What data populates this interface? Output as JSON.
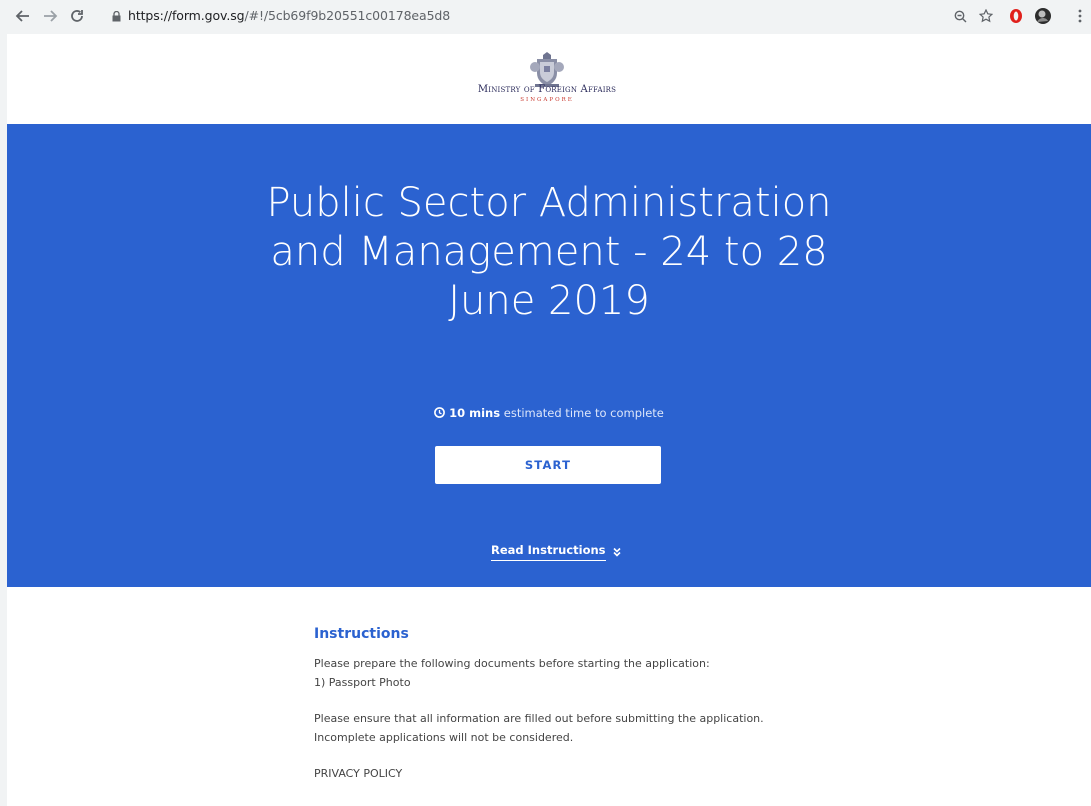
{
  "browser": {
    "url_host": "https://form.gov.sg",
    "url_path": "/#!/5cb69f9b20551c00178ea5d8",
    "icons": [
      "back-arrow-icon",
      "forward-arrow-icon",
      "reload-icon",
      "lock-icon",
      "zoom-icon",
      "star-icon",
      "opera-icon",
      "profile-icon",
      "menu-dots-icon"
    ]
  },
  "header": {
    "ministry_line": "Ministry of Foreign Affairs",
    "ministry_small": "SINGAPORE"
  },
  "hero": {
    "title": "Public Sector Administration and Management - 24 to 28 June 2019",
    "eta_value": "10 mins",
    "eta_text": "estimated time to complete",
    "start_label": "START",
    "read_instructions_label": "Read Instructions",
    "bg_color": "#2b62d0"
  },
  "instructions": {
    "title": "Instructions",
    "line1": "Please prepare the following documents before starting the application:",
    "line2": "1) Passport Photo",
    "line3": "Please ensure that all information are filled out before submitting the application.",
    "line4": "Incomplete applications will not be considered.",
    "line5": "PRIVACY POLICY"
  }
}
